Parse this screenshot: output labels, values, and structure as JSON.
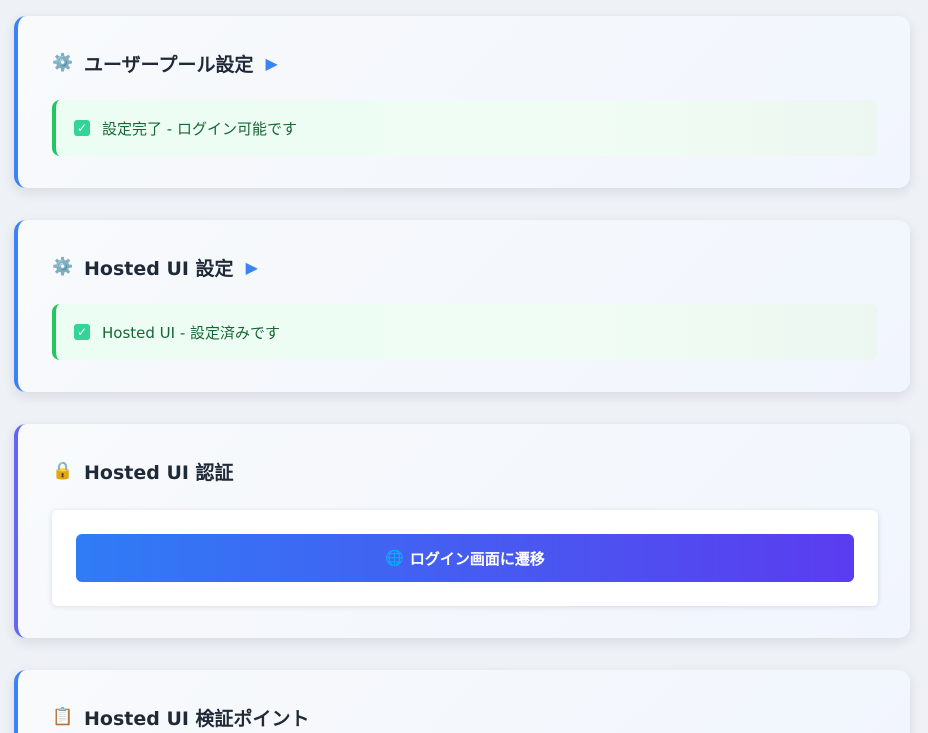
{
  "cards": {
    "user_pool": {
      "icon": "⚙️",
      "title": "ユーザープール設定",
      "arrow": "▶",
      "status_check": "✓",
      "status_text": "設定完了 - ログイン可能です"
    },
    "hosted_ui_settings": {
      "icon": "⚙️",
      "title": "Hosted UI 設定",
      "arrow": "▶",
      "status_check": "✓",
      "status_text": "Hosted UI - 設定済みです"
    },
    "hosted_ui_auth": {
      "icon": "🔒",
      "title": "Hosted UI 認証",
      "button_icon": "🌐",
      "button_label": "ログイン画面に遷移"
    },
    "verification": {
      "icon": "📋",
      "title": "Hosted UI 検証ポイント"
    }
  },
  "colors": {
    "accent_blue": "#3b82f6",
    "accent_purple": "#6366f1",
    "success_green": "#22c55e"
  },
  "icons": {
    "settings": "gear-icon",
    "lock": "lock-icon",
    "globe": "globe-icon",
    "clipboard": "clipboard-icon",
    "check": "check-icon",
    "expand": "play-arrow-icon"
  }
}
